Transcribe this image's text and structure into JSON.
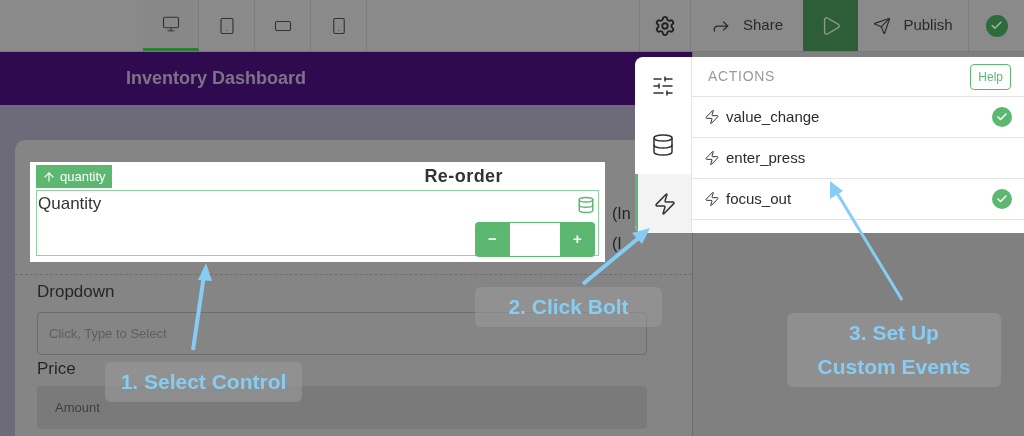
{
  "device_tabs": [
    {
      "kind": "desktop",
      "selected": true
    },
    {
      "kind": "tablet",
      "selected": false
    },
    {
      "kind": "landscape",
      "selected": false
    },
    {
      "kind": "phone",
      "selected": false
    }
  ],
  "toolbar": {
    "share": "Share",
    "publish": "Publish"
  },
  "header": {
    "title": "Inventory Dashboard"
  },
  "form": {
    "tag": "quantity",
    "title": "Re-order",
    "quantity_label": "Quantity",
    "stepper": {
      "minus": "−",
      "plus": "+"
    },
    "side_texts": [
      "(In",
      "(I"
    ],
    "dropdown": {
      "label": "Dropdown",
      "placeholder": "Click, Type to Select"
    },
    "price": {
      "label": "Price",
      "placeholder": "Amount"
    }
  },
  "panel": {
    "tabs": [
      {
        "kind": "settings",
        "selected": false
      },
      {
        "kind": "data",
        "selected": false
      },
      {
        "kind": "actions",
        "selected": true
      }
    ],
    "heading": "ACTIONS",
    "help": "Help",
    "actions": [
      {
        "name": "value_change",
        "configured": true
      },
      {
        "name": "enter_press",
        "configured": false
      },
      {
        "name": "focus_out",
        "configured": true
      }
    ]
  },
  "callouts": [
    {
      "text": "1. Select Control"
    },
    {
      "text": "2. Click Bolt"
    },
    {
      "text": "3. Set Up Custom Events"
    }
  ]
}
